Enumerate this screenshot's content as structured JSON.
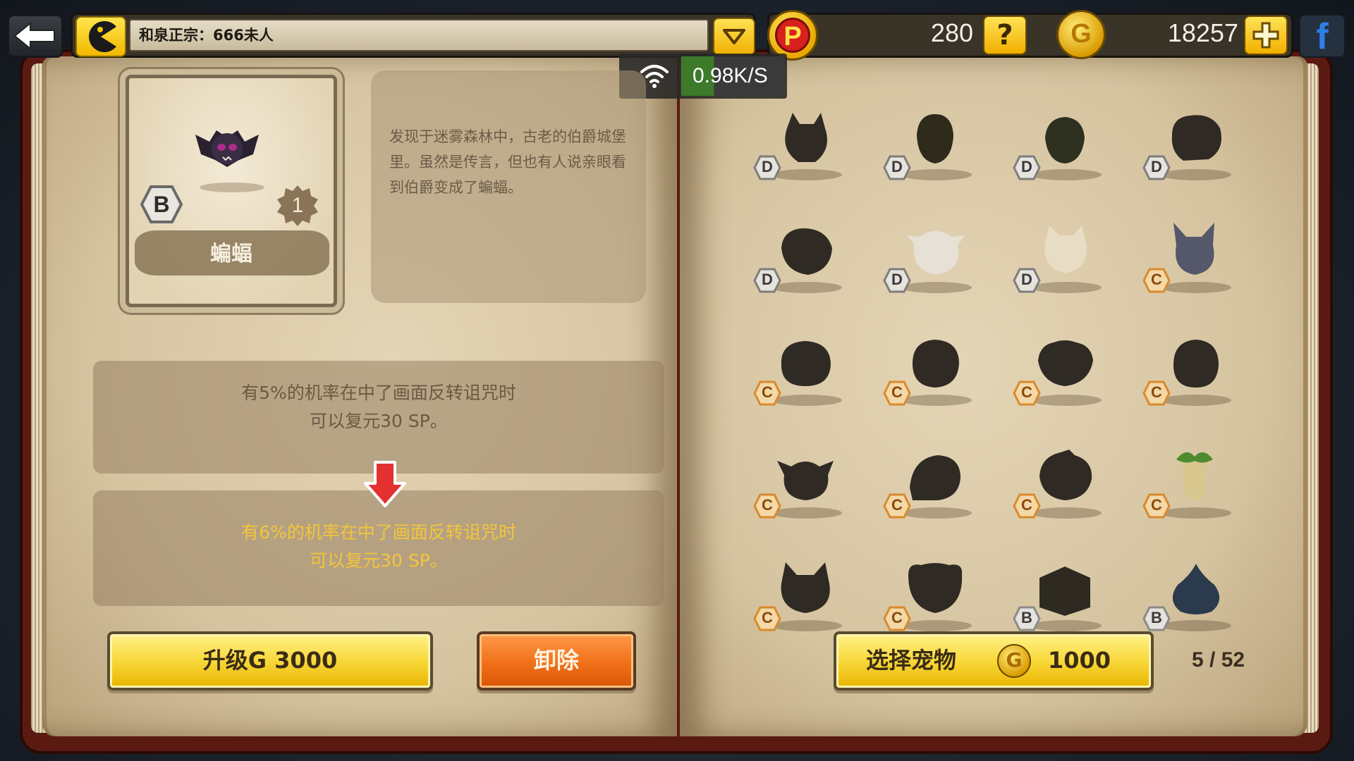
{
  "server": {
    "name": "和泉正宗：666未人"
  },
  "currency": {
    "points": "280",
    "points_icon": "P",
    "gold": "18257",
    "gold_icon": "G"
  },
  "network": {
    "speed": "0.98K/S"
  },
  "selected_pet": {
    "name": "蝙蝠",
    "rank": "B",
    "level": "1",
    "description": "发现于迷雾森林中，古老的伯爵城堡里。虽然是传言，但也有人说亲眼看到伯爵变成了蝙蝠。",
    "effect_current_line1": "有5%的机率在中了画面反转诅咒时",
    "effect_current_line2": "可以复元30 SP。",
    "effect_next_line1": "有6%的机率在中了画面反转诅咒时",
    "effect_next_line2": "可以复元30 SP。"
  },
  "buttons": {
    "upgrade": "升级G 3000",
    "remove": "卸除",
    "select_label": "选择宠物",
    "select_coin": "G",
    "select_cost": "1000"
  },
  "page_count": "5 / 52",
  "pets": [
    {
      "grade": "D",
      "kind": "cat"
    },
    {
      "grade": "D",
      "kind": "bee"
    },
    {
      "grade": "D",
      "kind": "fly"
    },
    {
      "grade": "D",
      "kind": "sheep"
    },
    {
      "grade": "D",
      "kind": "pig"
    },
    {
      "grade": "D",
      "kind": "cow"
    },
    {
      "grade": "D",
      "kind": "calico-cat"
    },
    {
      "grade": "C",
      "kind": "donkey"
    },
    {
      "grade": "C",
      "kind": "seal"
    },
    {
      "grade": "C",
      "kind": "beaver"
    },
    {
      "grade": "C",
      "kind": "dog"
    },
    {
      "grade": "C",
      "kind": "round-blob"
    },
    {
      "grade": "C",
      "kind": "ox"
    },
    {
      "grade": "C",
      "kind": "snail"
    },
    {
      "grade": "C",
      "kind": "boar"
    },
    {
      "grade": "C",
      "kind": "mandrake"
    },
    {
      "grade": "C",
      "kind": "wolf"
    },
    {
      "grade": "C",
      "kind": "mouse"
    },
    {
      "grade": "B",
      "kind": "treasure-chest"
    },
    {
      "grade": "B",
      "kind": "slime"
    }
  ],
  "colors": {
    "grade_d": "#7d7d7d",
    "grade_c": "#d98a2c",
    "grade_b": "#8a8a8a"
  }
}
